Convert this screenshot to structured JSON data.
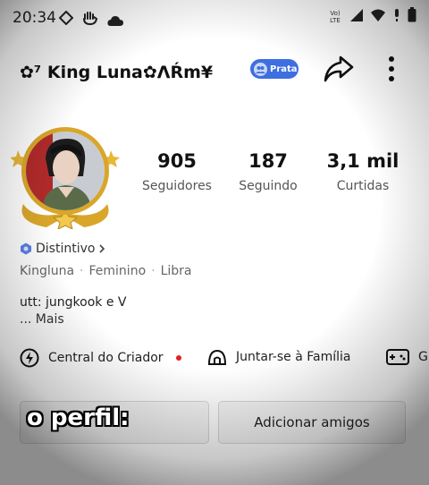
{
  "status_bar": {
    "time": "20:34",
    "network": "Vo) LTE"
  },
  "header": {
    "username": "✿⁷ King Luna✿ΛŔm¥",
    "badge_label": "Prata"
  },
  "stats": [
    {
      "value": "905",
      "label": "Seguidores"
    },
    {
      "value": "187",
      "label": "Seguindo"
    },
    {
      "value": "3,1 mil",
      "label": "Curtidas"
    }
  ],
  "profile": {
    "badge_link": "Distintivo",
    "name": "Kingluna",
    "gender": "Feminino",
    "sign": "Libra",
    "bio": "utt: jungkook e V",
    "more": "... Mais"
  },
  "actions": {
    "creator_center": "Central do Criador",
    "join_family": "Juntar-se à Família",
    "games_partial": "G"
  },
  "buttons": {
    "add_friends": "Adicionar amigos"
  },
  "overlay": {
    "caption": "o perfil:"
  },
  "colors": {
    "badge_blue": "#3e6fe0",
    "avatar_gold": "#d9a62a",
    "notification_red": "#e02020"
  }
}
